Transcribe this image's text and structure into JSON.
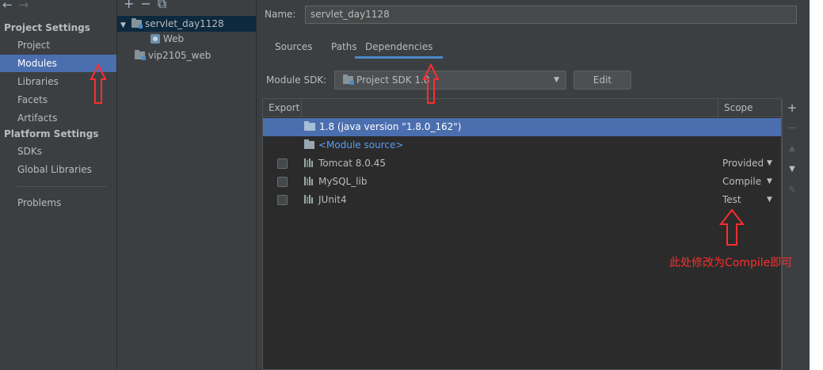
{
  "nav": {
    "back_arrow": "←",
    "forward_arrow": "→",
    "project_settings_title": "Project Settings",
    "project_items": [
      "Project",
      "Modules",
      "Libraries",
      "Facets",
      "Artifacts"
    ],
    "platform_settings_title": "Platform Settings",
    "platform_items": [
      "SDKs",
      "Global Libraries"
    ],
    "problems": "Problems",
    "selected": "Modules"
  },
  "tree": {
    "toolbar": [
      "+",
      "−",
      "⧉"
    ],
    "modules": [
      {
        "label": "servlet_day1128",
        "expanded": true,
        "children": [
          "Web"
        ]
      },
      {
        "label": "vip2105_web",
        "expanded": false
      }
    ]
  },
  "main": {
    "name_label": "Name:",
    "name_value": "servlet_day1128",
    "tabs": [
      "Sources",
      "Paths",
      "Dependencies"
    ],
    "active_tab": "Dependencies",
    "sdk_label": "Module SDK:",
    "sdk_value": "Project SDK 1.8",
    "edit_button": "Edit",
    "table": {
      "col_export": "Export",
      "col_scope": "Scope",
      "rows": [
        {
          "name": "1.8 (java version \"1.8.0_162\")",
          "scope": "",
          "selected": true,
          "checkbox": false
        },
        {
          "name": "<Module source>",
          "scope": "",
          "selected": false,
          "checkbox": false
        },
        {
          "name": "Tomcat 8.0.45",
          "scope": "Provided",
          "selected": false,
          "checkbox": true
        },
        {
          "name": "MySQL_lib",
          "scope": "Compile",
          "selected": false,
          "checkbox": true
        },
        {
          "name": "JUnit4",
          "scope": "Test",
          "selected": false,
          "checkbox": true
        }
      ]
    },
    "tools": [
      "+",
      "−",
      "▲",
      "▼",
      "✎"
    ]
  },
  "annotation": {
    "note": "此处修改为Compile即可",
    "color": "#ff2d2d"
  }
}
